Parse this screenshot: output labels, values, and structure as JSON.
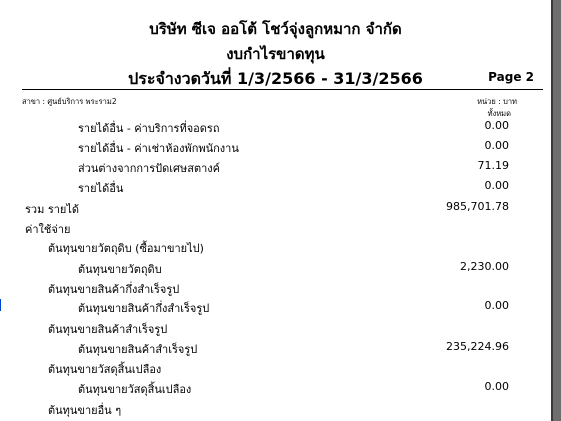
{
  "header": {
    "company": "บริษัท ซีเจ ออโต้ โชว์จุ่งลูกหมาก จำกัด",
    "report_title": "งบกำไรขาดทุน",
    "period": "ประจำงวดวันที่ 1/3/2566 - 31/3/2566",
    "page": "Page 2",
    "branch": "สาขา : ศูนย์บริการ พระราม2",
    "unit": "หน่วย : บาท",
    "scope": "ทั้งหมด"
  },
  "rows": [
    {
      "label": "รายได้อื่น - ค่าบริการที่จอดรถ",
      "value": "0.00"
    },
    {
      "label": "รายได้อื่น - ค่าเช่าห้องพักพนักงาน",
      "value": "0.00"
    },
    {
      "label": "ส่วนต่างจากการปัดเศษสตางค์",
      "value": "71.19"
    },
    {
      "label": "รายได้อื่น",
      "value": "0.00"
    },
    {
      "label": "รวม รายได้",
      "value": "985,701.78"
    },
    {
      "label": "ค่าใช้จ่าย",
      "value": ""
    },
    {
      "label": "ต้นทุนขายวัตถุดิบ (ซื้อมาขายไป)",
      "value": ""
    },
    {
      "label": "ต้นทุนขายวัตถุดิบ",
      "value": "2,230.00"
    },
    {
      "label": "ต้นทุนขายสินค้ากึ่งสำเร็จรูป",
      "value": ""
    },
    {
      "label": "ต้นทุนขายสินค้ากึ่งสำเร็จรูป",
      "value": "0.00"
    },
    {
      "label": "ต้นทุนขายสินค้าสำเร็จรูป",
      "value": ""
    },
    {
      "label": "ต้นทุนขายสินค้าสำเร็จรูป",
      "value": "235,224.96"
    },
    {
      "label": "ต้นทุนขายวัสดุสิ้นเปลือง",
      "value": ""
    },
    {
      "label": "ต้นทุนขายวัสดุสิ้นเปลือง",
      "value": "0.00"
    },
    {
      "label": "ต้นทุนขายอื่น ๆ",
      "value": ""
    }
  ]
}
